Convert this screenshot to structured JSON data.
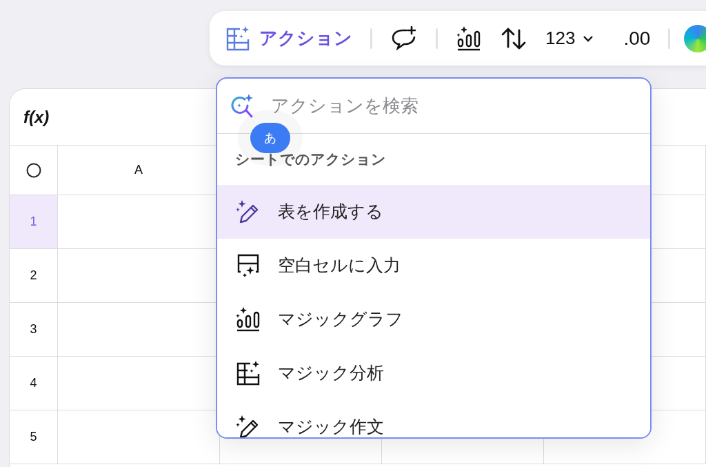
{
  "toolbar": {
    "action_button": {
      "label": "アクション"
    },
    "number_format": {
      "label": "123"
    },
    "decimal_button": {
      "label": ".00"
    }
  },
  "sheet": {
    "formula_label": "f(x)",
    "columns": [
      "A"
    ],
    "rows": [
      {
        "label": "1",
        "selected": true
      },
      {
        "label": "2",
        "selected": false
      },
      {
        "label": "3",
        "selected": false
      },
      {
        "label": "4",
        "selected": false
      },
      {
        "label": "5",
        "selected": false
      }
    ]
  },
  "action_menu": {
    "search": {
      "placeholder": "アクションを検索"
    },
    "ime_badge": "あ",
    "section_title": "シートでのアクション",
    "items": [
      {
        "label": "表を作成する",
        "kind": "pencil",
        "selected": true
      },
      {
        "label": "空白セルに入力",
        "kind": "fill",
        "selected": false
      },
      {
        "label": "マジックグラフ",
        "kind": "chart",
        "selected": false
      },
      {
        "label": "マジック分析",
        "kind": "table",
        "selected": false
      },
      {
        "label": "マジック作文",
        "kind": "pencil",
        "selected": false
      }
    ]
  }
}
